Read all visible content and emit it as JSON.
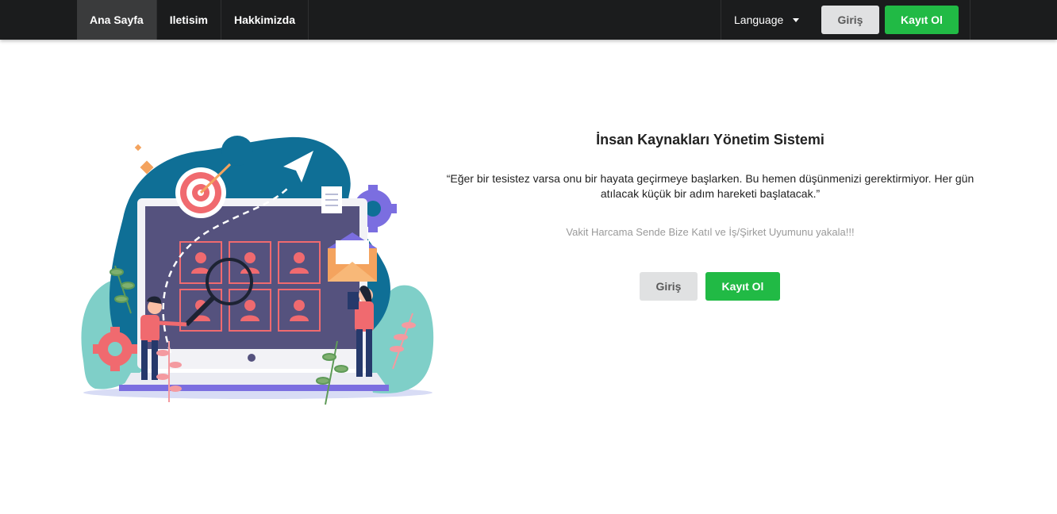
{
  "nav": {
    "items": [
      {
        "label": "Ana Sayfa",
        "active": true
      },
      {
        "label": "Iletisim",
        "active": false
      },
      {
        "label": "Hakkimizda",
        "active": false
      }
    ],
    "language_label": "Language",
    "login_label": "Giriş",
    "register_label": "Kayıt Ol"
  },
  "hero": {
    "title": "İnsan Kaynakları Yönetim Sistemi",
    "quote": "“Eğer bir tesistez varsa onu bir hayata geçirmeye başlarken. Bu hemen düşünmenizi gerektirmiyor. Her gün atılacak küçük bir adım hareketi başlatacak.”",
    "subtitle": "Vakit Harcama Sende Bize Katıl ve İş/Şirket Uyumunu yakala!!!",
    "login_label": "Giriş",
    "register_label": "Kayıt Ol"
  },
  "colors": {
    "navbar": "#1b1c1d",
    "green": "#21ba45",
    "grey_button": "#e0e1e2",
    "blob_blue": "#0f6f96",
    "monitor": "#55527e",
    "accent_red": "#f06a6f"
  }
}
